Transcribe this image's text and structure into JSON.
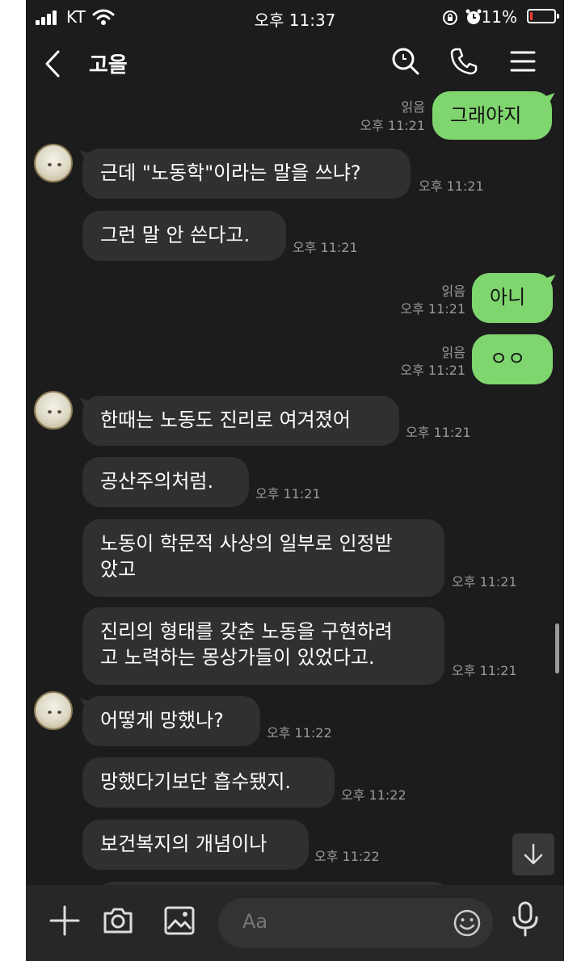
{
  "status_bar": {
    "carrier": "KT",
    "time": "오후 11:37",
    "battery_percent": "11%",
    "battery_level": 0.11,
    "icons": [
      "signal-icon",
      "wifi-icon",
      "rotation-lock-icon",
      "alarm-icon",
      "battery-icon"
    ]
  },
  "header": {
    "title": "고을",
    "icons": [
      "back-icon",
      "search-icon",
      "phone-icon",
      "menu-icon"
    ]
  },
  "messages": [
    {
      "sender": "me",
      "text": "그래야지",
      "read": "읽음",
      "time": "오후 11:21"
    },
    {
      "sender": "other",
      "text": "근데 \"노동학\"이라는 말을 쓰냐?",
      "time": "오후 11:21"
    },
    {
      "sender": "other",
      "text": "그런 말 안 쓴다고.",
      "time": "오후 11:21"
    },
    {
      "sender": "me",
      "text": "아니",
      "read": "읽음",
      "time": "오후 11:21"
    },
    {
      "sender": "me",
      "text": "ㅇㅇ",
      "read": "읽음",
      "time": "오후 11:21"
    },
    {
      "sender": "other",
      "text": "한때는 노동도 진리로 여겨졌어",
      "time": "오후 11:21"
    },
    {
      "sender": "other",
      "text": "공산주의처럼.",
      "time": "오후 11:21"
    },
    {
      "sender": "other",
      "lines": [
        "노동이 학문적 사상의 일부로 인정받",
        "았고"
      ],
      "time": "오후 11:21"
    },
    {
      "sender": "other",
      "lines": [
        "진리의 형태를 갖춘 노동을 구현하려",
        "고 노력하는 몽상가들이 있었다고."
      ],
      "time": "오후 11:21"
    },
    {
      "sender": "other",
      "text": "어떻게 망했나?",
      "time": "오후 11:22"
    },
    {
      "sender": "other",
      "text": "망했다기보단 흡수됐지.",
      "time": "오후 11:22"
    },
    {
      "sender": "other",
      "text": "보건복지의 개념이나",
      "time": "오후 11:22"
    }
  ],
  "input": {
    "placeholder": "Aa"
  },
  "bottom_bar": {
    "icons": [
      "plus-icon",
      "camera-icon",
      "gallery-icon",
      "emoji-icon",
      "microphone-icon",
      "scroll-down-icon"
    ]
  }
}
